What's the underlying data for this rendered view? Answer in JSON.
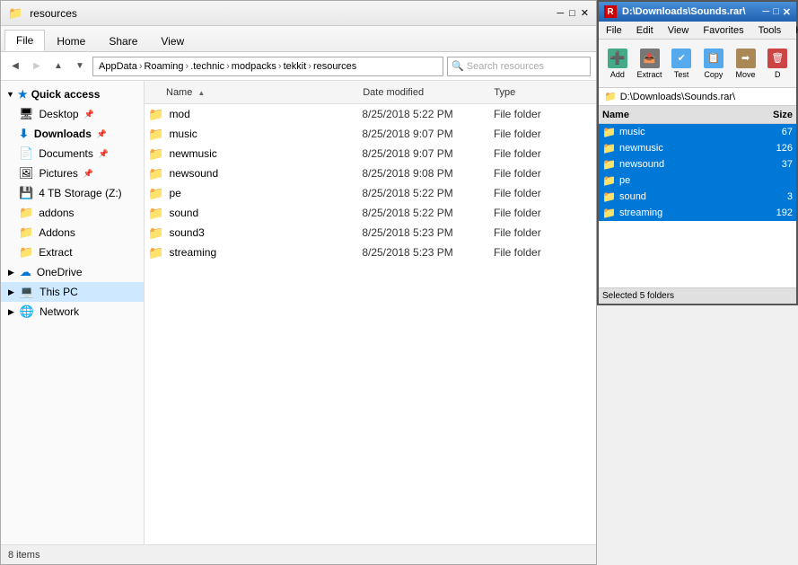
{
  "explorer": {
    "title": "resources",
    "tabs": [
      {
        "id": "file",
        "label": "File"
      },
      {
        "id": "home",
        "label": "Home"
      },
      {
        "id": "share",
        "label": "Share"
      },
      {
        "id": "view",
        "label": "View"
      }
    ],
    "address_path": [
      {
        "segment": "AppData"
      },
      {
        "segment": "Roaming"
      },
      {
        "segment": ".technic"
      },
      {
        "segment": "modpacks"
      },
      {
        "segment": "tekkit"
      },
      {
        "segment": "resources"
      }
    ],
    "sidebar": {
      "items": [
        {
          "id": "quick-access",
          "label": "Quick access",
          "type": "section",
          "icon": "★"
        },
        {
          "id": "desktop",
          "label": "Desktop",
          "type": "item",
          "icon": "🖥",
          "pinned": true
        },
        {
          "id": "downloads",
          "label": "Downloads",
          "type": "item",
          "icon": "⬇",
          "pinned": true,
          "bold": true
        },
        {
          "id": "documents",
          "label": "Documents",
          "type": "item",
          "icon": "📄",
          "pinned": true
        },
        {
          "id": "pictures",
          "label": "Pictures",
          "type": "item",
          "icon": "🖼",
          "pinned": true
        },
        {
          "id": "storage",
          "label": "4 TB Storage (Z:)",
          "type": "item",
          "icon": "💾"
        },
        {
          "id": "addons1",
          "label": "addons",
          "type": "item",
          "icon": "📁"
        },
        {
          "id": "addons2",
          "label": "Addons",
          "type": "item",
          "icon": "📁"
        },
        {
          "id": "extract",
          "label": "Extract",
          "type": "item",
          "icon": "📁"
        },
        {
          "id": "onedrive",
          "label": "OneDrive",
          "type": "item",
          "icon": "☁"
        },
        {
          "id": "this-pc",
          "label": "This PC",
          "type": "item",
          "icon": "💻",
          "selected": true
        },
        {
          "id": "network",
          "label": "Network",
          "type": "item",
          "icon": "🌐"
        }
      ]
    },
    "files": {
      "columns": [
        "Name",
        "Date modified",
        "Type"
      ],
      "rows": [
        {
          "name": "mod",
          "date": "8/25/2018 5:22 PM",
          "type": "File folder"
        },
        {
          "name": "music",
          "date": "8/25/2018 9:07 PM",
          "type": "File folder"
        },
        {
          "name": "newmusic",
          "date": "8/25/2018 9:07 PM",
          "type": "File folder"
        },
        {
          "name": "newsound",
          "date": "8/25/2018 9:08 PM",
          "type": "File folder"
        },
        {
          "name": "pe",
          "date": "8/25/2018 5:22 PM",
          "type": "File folder"
        },
        {
          "name": "sound",
          "date": "8/25/2018 5:22 PM",
          "type": "File folder"
        },
        {
          "name": "sound3",
          "date": "8/25/2018 5:23 PM",
          "type": "File folder"
        },
        {
          "name": "streaming",
          "date": "8/25/2018 5:23 PM",
          "type": "File folder"
        }
      ]
    },
    "status": {
      "items_count": "8 items"
    }
  },
  "winrar": {
    "title": "D:\\Downloads\\Sounds.rar\\",
    "menu_items": [
      "File",
      "Edit",
      "View",
      "Favorites",
      "Tools",
      "Help"
    ],
    "toolbar_buttons": [
      {
        "id": "add",
        "label": "Add",
        "icon": "➕"
      },
      {
        "id": "extract",
        "label": "Extract",
        "icon": "📤"
      },
      {
        "id": "test",
        "label": "Test",
        "icon": "🔬"
      },
      {
        "id": "copy",
        "label": "Copy",
        "icon": "📋"
      },
      {
        "id": "move",
        "label": "Move",
        "icon": "➡"
      },
      {
        "id": "delete",
        "label": "D",
        "icon": "✖"
      }
    ],
    "address": "D:\\Downloads\\Sounds.rar\\",
    "columns": [
      "Name",
      "Size"
    ],
    "files": [
      {
        "name": "music",
        "size": "67",
        "selected": true
      },
      {
        "name": "newmusic",
        "size": "126",
        "selected": true
      },
      {
        "name": "newsound",
        "size": "37",
        "selected": true
      },
      {
        "name": "pe",
        "size": "",
        "selected": true
      },
      {
        "name": "sound",
        "size": "3",
        "selected": true
      },
      {
        "name": "streaming",
        "size": "192",
        "selected": true
      }
    ]
  }
}
